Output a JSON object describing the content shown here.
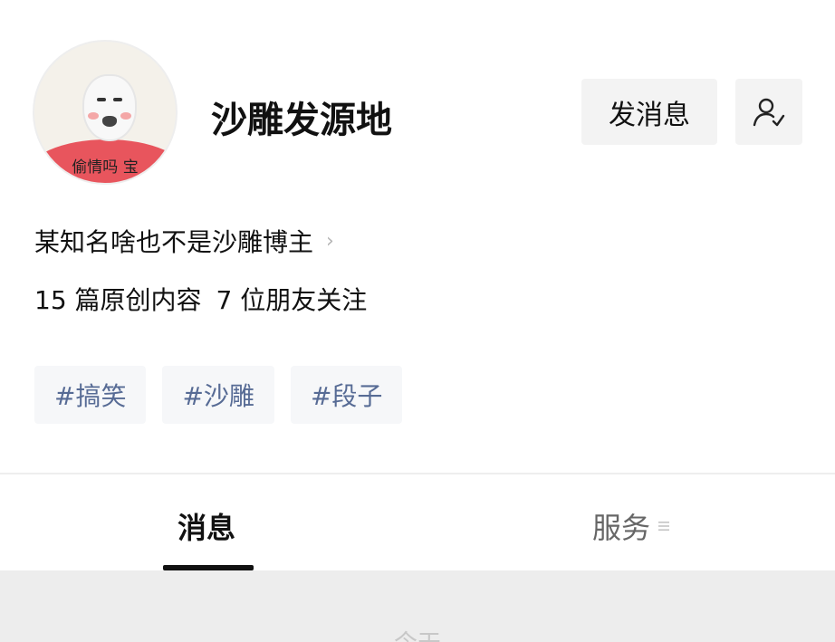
{
  "profile": {
    "avatar_caption": "偷情吗 宝",
    "name": "沙雕发源地",
    "send_message_label": "发消息",
    "follow_icon": "person-check-icon",
    "bio": "某知名啥也不是沙雕博主",
    "original_count": "15 篇原创内容",
    "friends_following": "7 位朋友关注",
    "tags": [
      "#搞笑",
      "#沙雕",
      "#段子"
    ]
  },
  "tabs": {
    "messages": "消息",
    "services": "服务",
    "services_icon": "menu-icon",
    "active": "消息"
  },
  "content": {
    "date_divider": "今天"
  },
  "colors": {
    "tag_text": "#576b95",
    "tag_bg": "#f6f7f9",
    "button_bg": "#f3f3f3",
    "avatar_shirt": "#e8555d"
  }
}
